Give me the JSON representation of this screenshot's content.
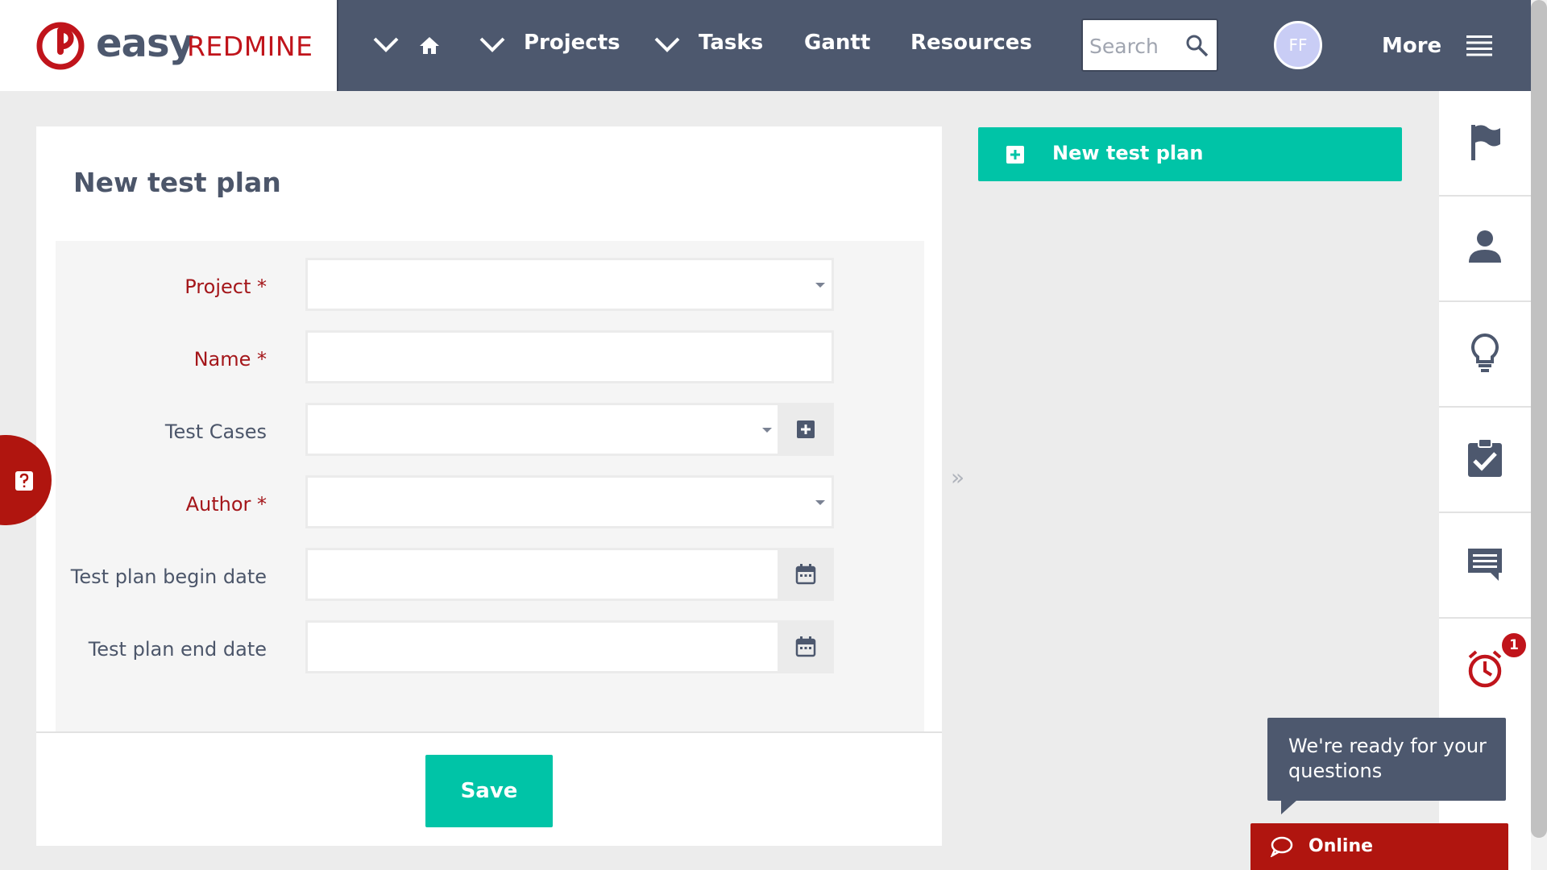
{
  "brand": {
    "easy": "easy",
    "redmine": "REDMINE"
  },
  "nav": {
    "items": [
      "Projects",
      "Tasks",
      "Gantt",
      "Resources"
    ],
    "more": "More"
  },
  "search": {
    "placeholder": "Search"
  },
  "user": {
    "initials": "FF"
  },
  "page": {
    "title": "New test plan"
  },
  "form": {
    "fields": [
      {
        "label": "Project *",
        "type": "select",
        "required": true,
        "value": ""
      },
      {
        "label": "Name *",
        "type": "text",
        "required": true,
        "value": ""
      },
      {
        "label": "Test Cases",
        "type": "select",
        "required": false,
        "value": ""
      },
      {
        "label": "Author *",
        "type": "select",
        "required": true,
        "value": ""
      },
      {
        "label": "Test plan begin date",
        "type": "date",
        "required": false,
        "value": ""
      },
      {
        "label": "Test plan end date",
        "type": "date",
        "required": false,
        "value": ""
      }
    ],
    "save_label": "Save"
  },
  "sidebar": {
    "new_test_plan": "New test plan",
    "collapse": "»"
  },
  "right_rail": {
    "icons": [
      "flag-icon",
      "person-icon",
      "lightbulb-icon",
      "clipboard-check-icon",
      "chat-icon",
      "alarm-clock-icon"
    ],
    "alarm_badge": "1"
  },
  "chat": {
    "bubble": "We're ready for your questions",
    "status": "Online"
  },
  "colors": {
    "topbar": "#4d586e",
    "accent": "#00c4a7",
    "required": "#a4161a",
    "brand_red": "#c0141b"
  }
}
